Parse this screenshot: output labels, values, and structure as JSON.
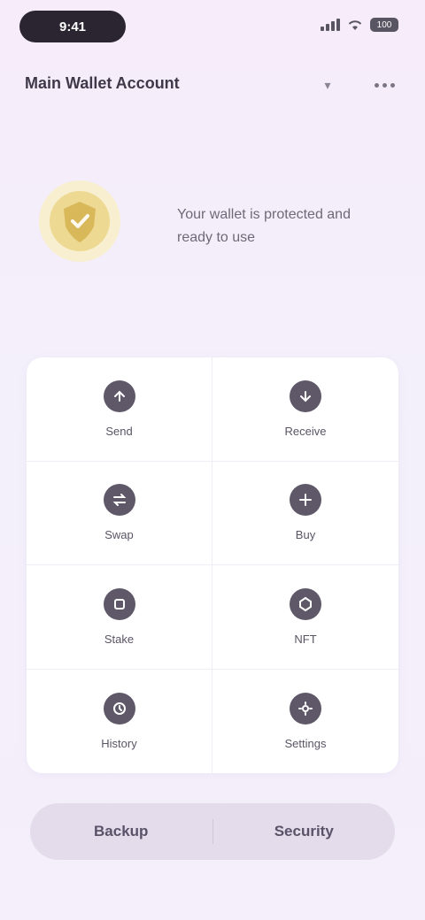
{
  "status_bar": {
    "time": "9:41",
    "battery": "100"
  },
  "header": {
    "account_title": "Main Wallet Account"
  },
  "hero": {
    "message": "Your wallet is protected and ready to use"
  },
  "grid": {
    "items": [
      {
        "label": "Send",
        "icon": "send-icon"
      },
      {
        "label": "Receive",
        "icon": "receive-icon"
      },
      {
        "label": "Swap",
        "icon": "swap-icon"
      },
      {
        "label": "Buy",
        "icon": "buy-icon"
      },
      {
        "label": "Stake",
        "icon": "stake-icon"
      },
      {
        "label": "NFT",
        "icon": "nft-icon"
      },
      {
        "label": "History",
        "icon": "history-icon"
      },
      {
        "label": "Settings",
        "icon": "settings-icon"
      }
    ]
  },
  "actions": {
    "primary_label": "Backup",
    "secondary_label": "Security"
  },
  "colors": {
    "accent_gold": "#e8c96a",
    "icon_dark": "#5e5868",
    "action_bar": "#e4dcea"
  }
}
